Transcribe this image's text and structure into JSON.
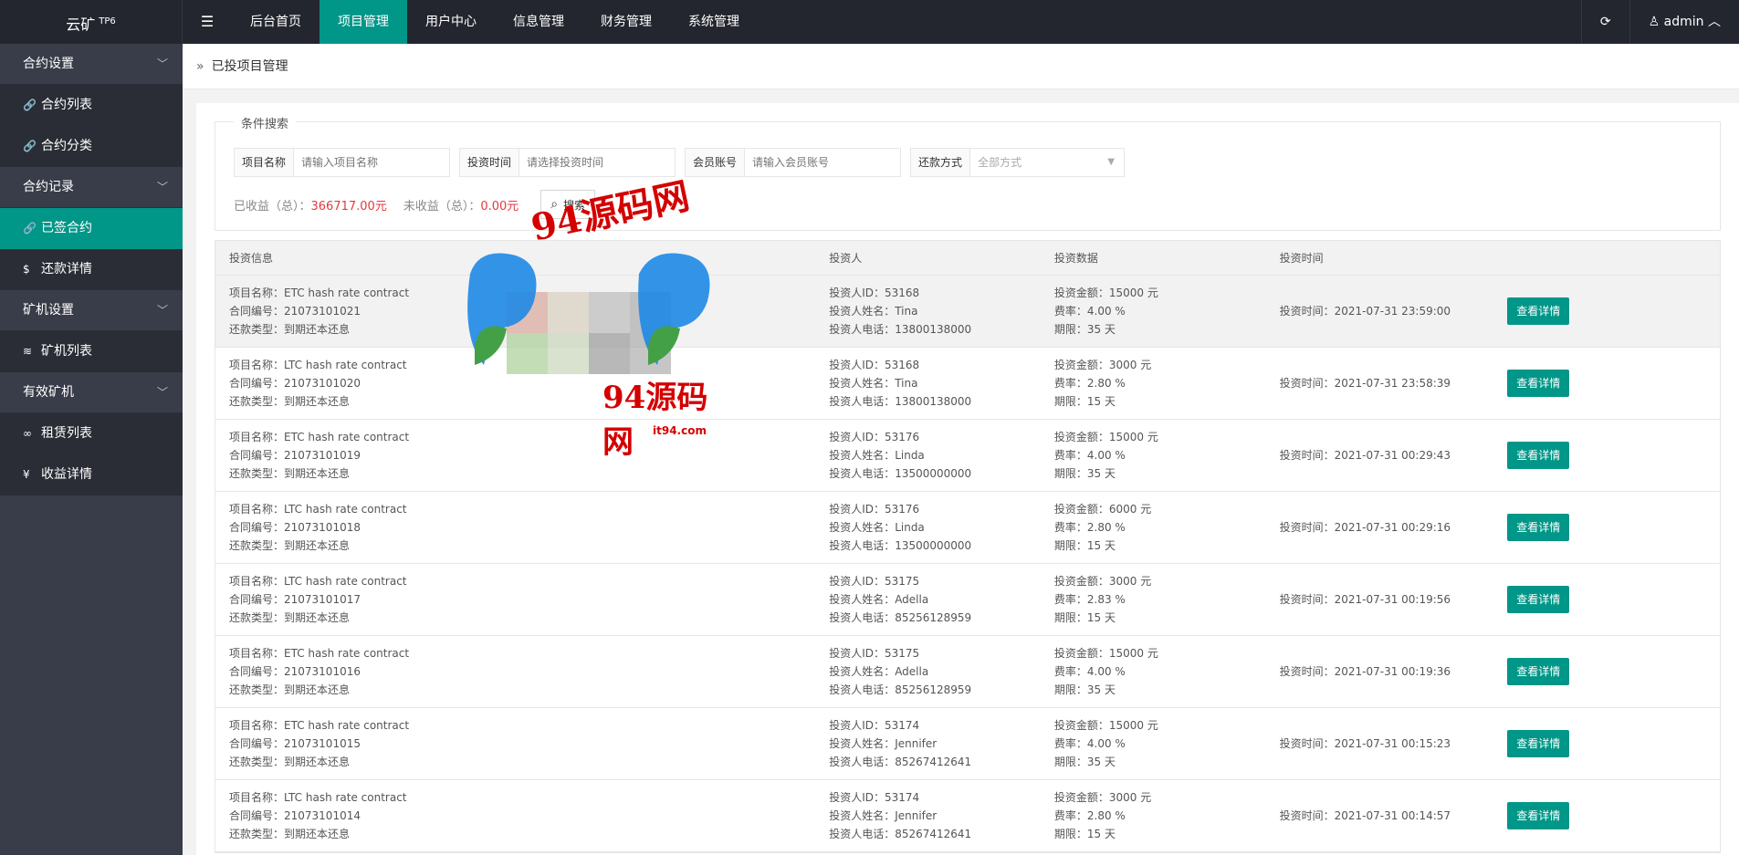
{
  "header": {
    "logo": "云矿",
    "logo_sup": "TP6",
    "toggle_icon": "☰",
    "nav": [
      "后台首页",
      "项目管理",
      "用户中心",
      "信息管理",
      "财务管理",
      "系统管理"
    ],
    "refresh_icon": "⟳",
    "user": "admin",
    "user_icon": "user-icon"
  },
  "sidebar": {
    "groups": [
      {
        "label": "合约设置",
        "items": [
          {
            "label": "合约列表",
            "icon": "🔗"
          },
          {
            "label": "合约分类",
            "icon": "🔗"
          }
        ]
      },
      {
        "label": "合约记录",
        "items": [
          {
            "label": "已签合约",
            "icon": "🔗"
          },
          {
            "label": "还款详情",
            "icon": "$"
          }
        ]
      },
      {
        "label": "矿机设置",
        "items": [
          {
            "label": "矿机列表",
            "icon": "≋"
          }
        ]
      },
      {
        "label": "有效矿机",
        "items": [
          {
            "label": "租赁列表",
            "icon": "∞"
          },
          {
            "label": "收益详情",
            "icon": "¥"
          }
        ]
      }
    ]
  },
  "breadcrumb": {
    "icon": "»",
    "text": "已投项目管理"
  },
  "search": {
    "legend": "条件搜索",
    "project_label": "项目名称",
    "project_placeholder": "请输入项目名称",
    "time_label": "投资时间",
    "time_placeholder": "请选择投资时间",
    "member_label": "会员账号",
    "member_placeholder": "请输入会员账号",
    "repay_label": "还款方式",
    "repay_value": "全部方式",
    "earned_label": "已收益（总）：",
    "earned_value": "366717.00元",
    "unearned_label": "未收益（总）：",
    "unearned_value": "0.00元",
    "search_btn": "搜索"
  },
  "table": {
    "headers": [
      "投资信息",
      "投资人",
      "投资数据",
      "投资时间",
      ""
    ],
    "detail_label": "查看详情",
    "rows": [
      {
        "name": "项目名称：ETC hash rate contract",
        "no": "合同编号：21073101021",
        "type": "还款类型：到期还本还息",
        "uid": "投资人ID：53168",
        "uname": "投资人姓名：Tina",
        "phone": "投资人电话：13800138000",
        "amount": "投资金额：15000 元",
        "rate": "费率：4.00 %",
        "term": "期限：35 天",
        "time": "投资时间：2021-07-31 23:59:00"
      },
      {
        "name": "项目名称：LTC hash rate contract",
        "no": "合同编号：21073101020",
        "type": "还款类型：到期还本还息",
        "uid": "投资人ID：53168",
        "uname": "投资人姓名：Tina",
        "phone": "投资人电话：13800138000",
        "amount": "投资金额：3000 元",
        "rate": "费率：2.80 %",
        "term": "期限：15 天",
        "time": "投资时间：2021-07-31 23:58:39"
      },
      {
        "name": "项目名称：ETC hash rate contract",
        "no": "合同编号：21073101019",
        "type": "还款类型：到期还本还息",
        "uid": "投资人ID：53176",
        "uname": "投资人姓名：Linda",
        "phone": "投资人电话：13500000000",
        "amount": "投资金额：15000 元",
        "rate": "费率：4.00 %",
        "term": "期限：35 天",
        "time": "投资时间：2021-07-31 00:29:43"
      },
      {
        "name": "项目名称：LTC hash rate contract",
        "no": "合同编号：21073101018",
        "type": "还款类型：到期还本还息",
        "uid": "投资人ID：53176",
        "uname": "投资人姓名：Linda",
        "phone": "投资人电话：13500000000",
        "amount": "投资金额：6000 元",
        "rate": "费率：2.80 %",
        "term": "期限：15 天",
        "time": "投资时间：2021-07-31 00:29:16"
      },
      {
        "name": "项目名称：LTC hash rate contract",
        "no": "合同编号：21073101017",
        "type": "还款类型：到期还本还息",
        "uid": "投资人ID：53175",
        "uname": "投资人姓名：Adella",
        "phone": "投资人电话：85256128959",
        "amount": "投资金额：3000 元",
        "rate": "费率：2.83 %",
        "term": "期限：15 天",
        "time": "投资时间：2021-07-31 00:19:56"
      },
      {
        "name": "项目名称：ETC hash rate contract",
        "no": "合同编号：21073101016",
        "type": "还款类型：到期还本还息",
        "uid": "投资人ID：53175",
        "uname": "投资人姓名：Adella",
        "phone": "投资人电话：85256128959",
        "amount": "投资金额：15000 元",
        "rate": "费率：4.00 %",
        "term": "期限：35 天",
        "time": "投资时间：2021-07-31 00:19:36"
      },
      {
        "name": "项目名称：ETC hash rate contract",
        "no": "合同编号：21073101015",
        "type": "还款类型：到期还本还息",
        "uid": "投资人ID：53174",
        "uname": "投资人姓名：Jennifer",
        "phone": "投资人电话：85267412641",
        "amount": "投资金额：15000 元",
        "rate": "费率：4.00 %",
        "term": "期限：35 天",
        "time": "投资时间：2021-07-31 00:15:23"
      },
      {
        "name": "项目名称：LTC hash rate contract",
        "no": "合同编号：21073101014",
        "type": "还款类型：到期还本还息",
        "uid": "投资人ID：53174",
        "uname": "投资人姓名：Jennifer",
        "phone": "投资人电话：85267412641",
        "amount": "投资金额：3000 元",
        "rate": "费率：2.80 %",
        "term": "期限：15 天",
        "time": "投资时间：2021-07-31 00:14:57"
      }
    ]
  },
  "watermark": {
    "text1": "94源码网",
    "text2": "94源码网",
    "text3": "it94.com"
  },
  "colors": {
    "accent": "#009688",
    "topbar": "#23262e",
    "sidebar": "#393d49",
    "money": "#e4393c"
  }
}
